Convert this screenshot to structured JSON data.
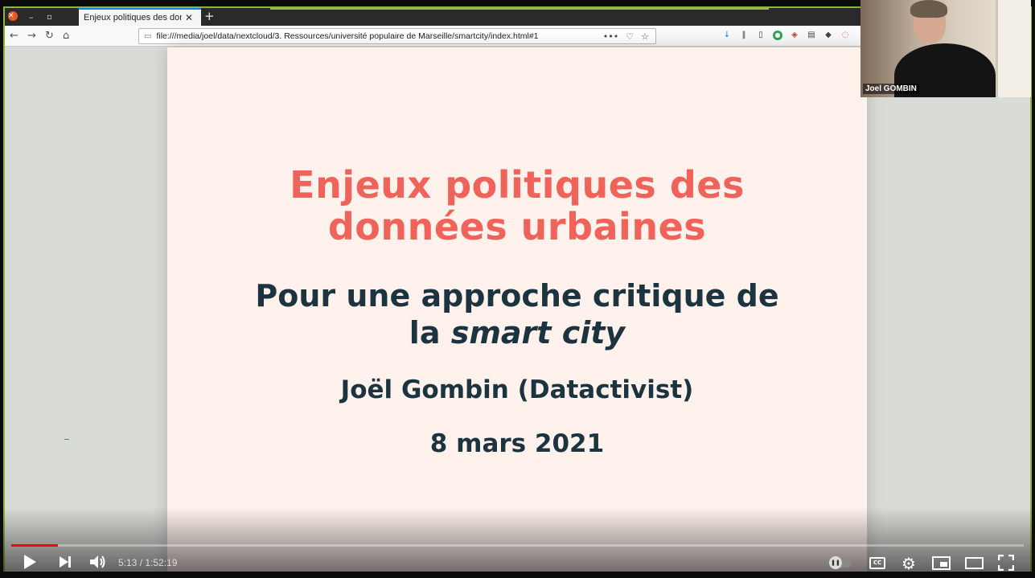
{
  "browser": {
    "tab_title": "Enjeux politiques des donn",
    "tab_close": "✕",
    "new_tab": "+",
    "url": "file:///media/joel/data/nextcloud/3. Ressources/université populaire de Marseille/smartcity/index.html#1"
  },
  "slide": {
    "title_line1": "Enjeux politiques des",
    "title_line2": "données urbaines",
    "subtitle_line1": "Pour une approche critique de",
    "subtitle_line2_prefix": "la ",
    "subtitle_line2_emph": "smart city",
    "author": "Joël Gombin (Datactivist)",
    "date": "8 mars 2021",
    "title_color": "#f0635a",
    "text_color": "#1c3340"
  },
  "webcam": {
    "name": "Joel GOMBIN"
  },
  "player": {
    "time": "5:13 / 1:52:19",
    "progress": 0.0464,
    "cc_label": "CC",
    "accent_color": "#ff0000"
  },
  "icons": {
    "back": "back-arrow-icon",
    "forward": "forward-arrow-icon",
    "reload": "reload-icon",
    "home": "home-icon",
    "play": "play-icon",
    "next": "next-icon",
    "volume": "volume-icon",
    "settings": "gear-icon",
    "fullscreen": "fullscreen-icon"
  }
}
